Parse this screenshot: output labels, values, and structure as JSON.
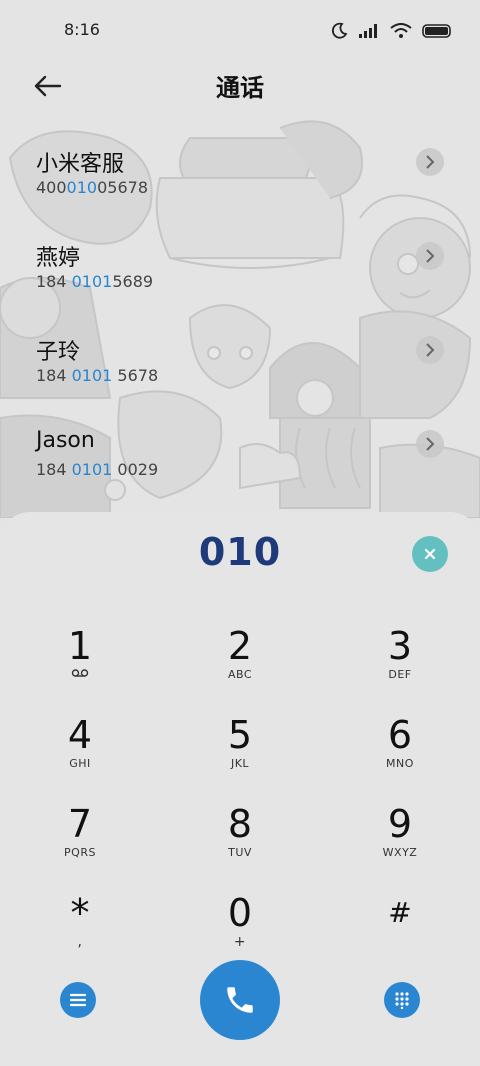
{
  "status": {
    "time": "8:16"
  },
  "appbar": {
    "title": "通话"
  },
  "contacts": [
    {
      "name": "小米客服",
      "num_pre": "400",
      "num_hl": "010",
      "num_post": "05678"
    },
    {
      "name": "燕婷",
      "num_pre": "184 ",
      "num_hl": "0101",
      "num_post": "5689"
    },
    {
      "name": "子玲",
      "num_pre": "184 ",
      "num_hl": "0101",
      "num_post": " 5678"
    },
    {
      "name": "Jason",
      "num_pre": "184 ",
      "num_hl": "0101",
      "num_post": " 0029"
    }
  ],
  "dialer": {
    "entered": "010",
    "keys": [
      {
        "num": "1",
        "letters": ""
      },
      {
        "num": "2",
        "letters": "ABC"
      },
      {
        "num": "3",
        "letters": "DEF"
      },
      {
        "num": "4",
        "letters": "GHI"
      },
      {
        "num": "5",
        "letters": "JKL"
      },
      {
        "num": "6",
        "letters": "MNO"
      },
      {
        "num": "7",
        "letters": "PQRS"
      },
      {
        "num": "8",
        "letters": "TUV"
      },
      {
        "num": "9",
        "letters": "WXYZ"
      },
      {
        "num": "*",
        "letters": ","
      },
      {
        "num": "0",
        "letters": "+"
      },
      {
        "num": "#",
        "letters": ""
      }
    ]
  },
  "colors": {
    "accent": "#2a86d0",
    "digits": "#1f3a7a",
    "clear": "#64c0c0"
  }
}
